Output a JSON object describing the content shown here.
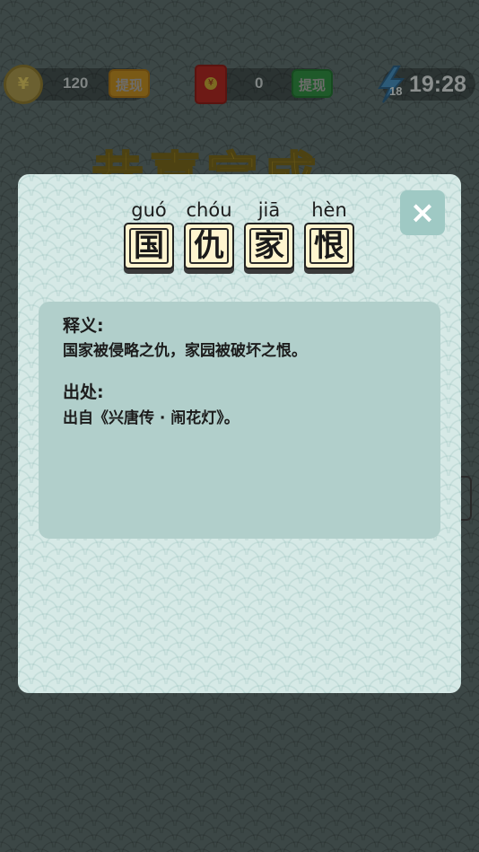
{
  "top_bar": {
    "coin_symbol": "¥",
    "coin_value": "120",
    "coin_withdraw_label": "提现",
    "redpacket_value": "0",
    "redpacket_withdraw_label": "提现",
    "energy_count": "18",
    "timer": "19:28"
  },
  "background": {
    "title": "恭喜完成"
  },
  "modal": {
    "idiom": [
      {
        "pinyin": "guó",
        "char": "国"
      },
      {
        "pinyin": "chóu",
        "char": "仇"
      },
      {
        "pinyin": "jiā",
        "char": "家"
      },
      {
        "pinyin": "hèn",
        "char": "恨"
      }
    ],
    "close_icon": "×",
    "meaning_heading": "释义:",
    "meaning_text": "国家被侵略之仇，家园被破坏之恨。",
    "source_heading": "出处:",
    "source_text": "出自《兴唐传 · 闹花灯》。"
  },
  "colors": {
    "modal_bg": "#d6e9e6",
    "info_box": "#b1cfcb",
    "tile_bg": "#fff5cf",
    "close_btn": "#9fc9c4"
  }
}
